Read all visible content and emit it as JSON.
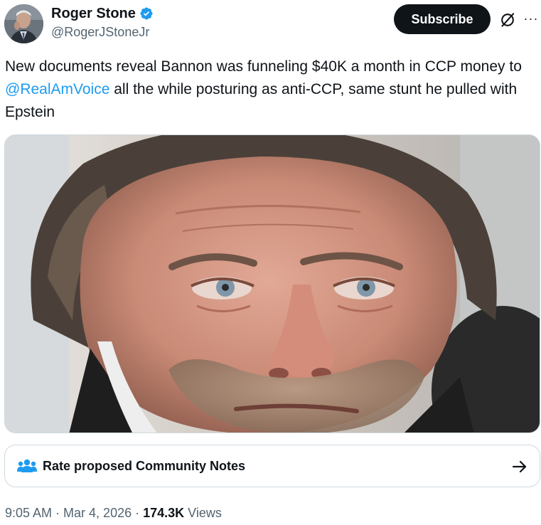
{
  "author": {
    "display_name": "Roger Stone",
    "handle": "@RogerJStoneJr",
    "avatar_icon": "profile-photo",
    "verified_icon": "verified-badge-icon",
    "verified_color": "#1d9bf0"
  },
  "actions": {
    "subscribe_label": "Subscribe",
    "grok_icon": "grok-icon",
    "more_icon": "more-icon",
    "more_label": "···"
  },
  "tweet": {
    "text_part1": "New documents reveal Bannon was funneling $40K a month in CCP money to ",
    "mention": "@RealAmVoice",
    "text_part2": " all the while posturing as anti-CCP, same stunt he pulled with Epstein",
    "mention_color": "#1d9bf0"
  },
  "media": {
    "kind": "photo",
    "subject": "close-up-portrait"
  },
  "community_notes": {
    "label": "Rate proposed Community Notes",
    "icon": "people-icon",
    "arrow_icon": "arrow-right-icon"
  },
  "meta": {
    "time": "9:05 AM",
    "separator1": " · ",
    "date": "Mar 4, 2026",
    "separator2": " · ",
    "views_count": "174.3K",
    "views_label": " Views"
  },
  "colors": {
    "text_primary": "#0f1419",
    "text_secondary": "#536471",
    "accent": "#1d9bf0",
    "border": "#cfd9de",
    "button_bg": "#0f1419"
  }
}
